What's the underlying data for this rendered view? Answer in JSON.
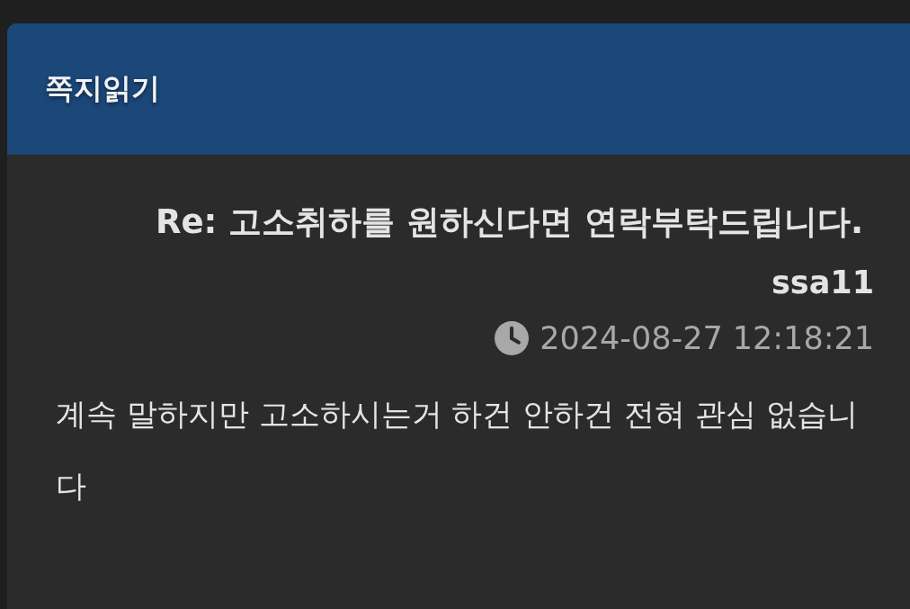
{
  "header": {
    "title": "쪽지읽기"
  },
  "message": {
    "subject": "Re: 고소취하를 원하신다면 연락부탁드립니다.",
    "sender": "ssa11",
    "date": "2024-08-27 12:18:21",
    "body": "계속 말하지만 고소하시는거 하건 안하건 전혀 관심 없습니다"
  }
}
